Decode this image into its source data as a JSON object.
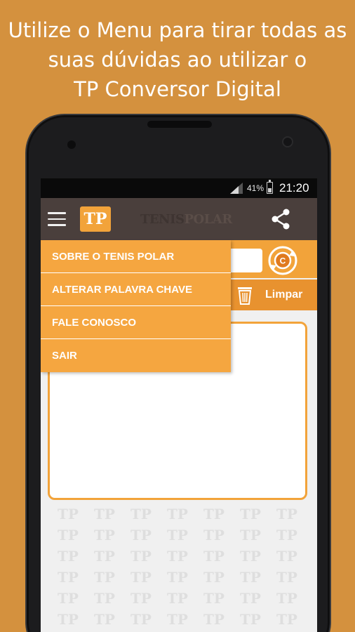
{
  "headline": {
    "line1": "Utilize o Menu para tirar todas as",
    "line2": "suas dúvidas ao utilizar o",
    "line3": "TP Conversor Digital"
  },
  "status_bar": {
    "battery_percent": "41%",
    "time": "21:20",
    "icons": [
      "signal-icon",
      "battery-icon"
    ]
  },
  "app_bar": {
    "logo_text": "TP",
    "brand_part1": "TENIS",
    "brand_part2": "POLAR",
    "menu_icon": "hamburger-menu-icon",
    "share_icon": "share-icon"
  },
  "menu": {
    "items": [
      {
        "label": "SOBRE O TENIS POLAR"
      },
      {
        "label": "ALTERAR PALAVRA CHAVE"
      },
      {
        "label": "FALE CONOSCO"
      },
      {
        "label": "SAIR"
      }
    ]
  },
  "toolbar": {
    "convert_icon": "convert-icon",
    "clear_icon": "trash-icon",
    "clear_label": "Limpar"
  },
  "watermark_text": "TP",
  "colors": {
    "background": "#D4913E",
    "accent": "#F2A33A",
    "appbar": "#4a3f3c",
    "menu": "#F5A640"
  }
}
